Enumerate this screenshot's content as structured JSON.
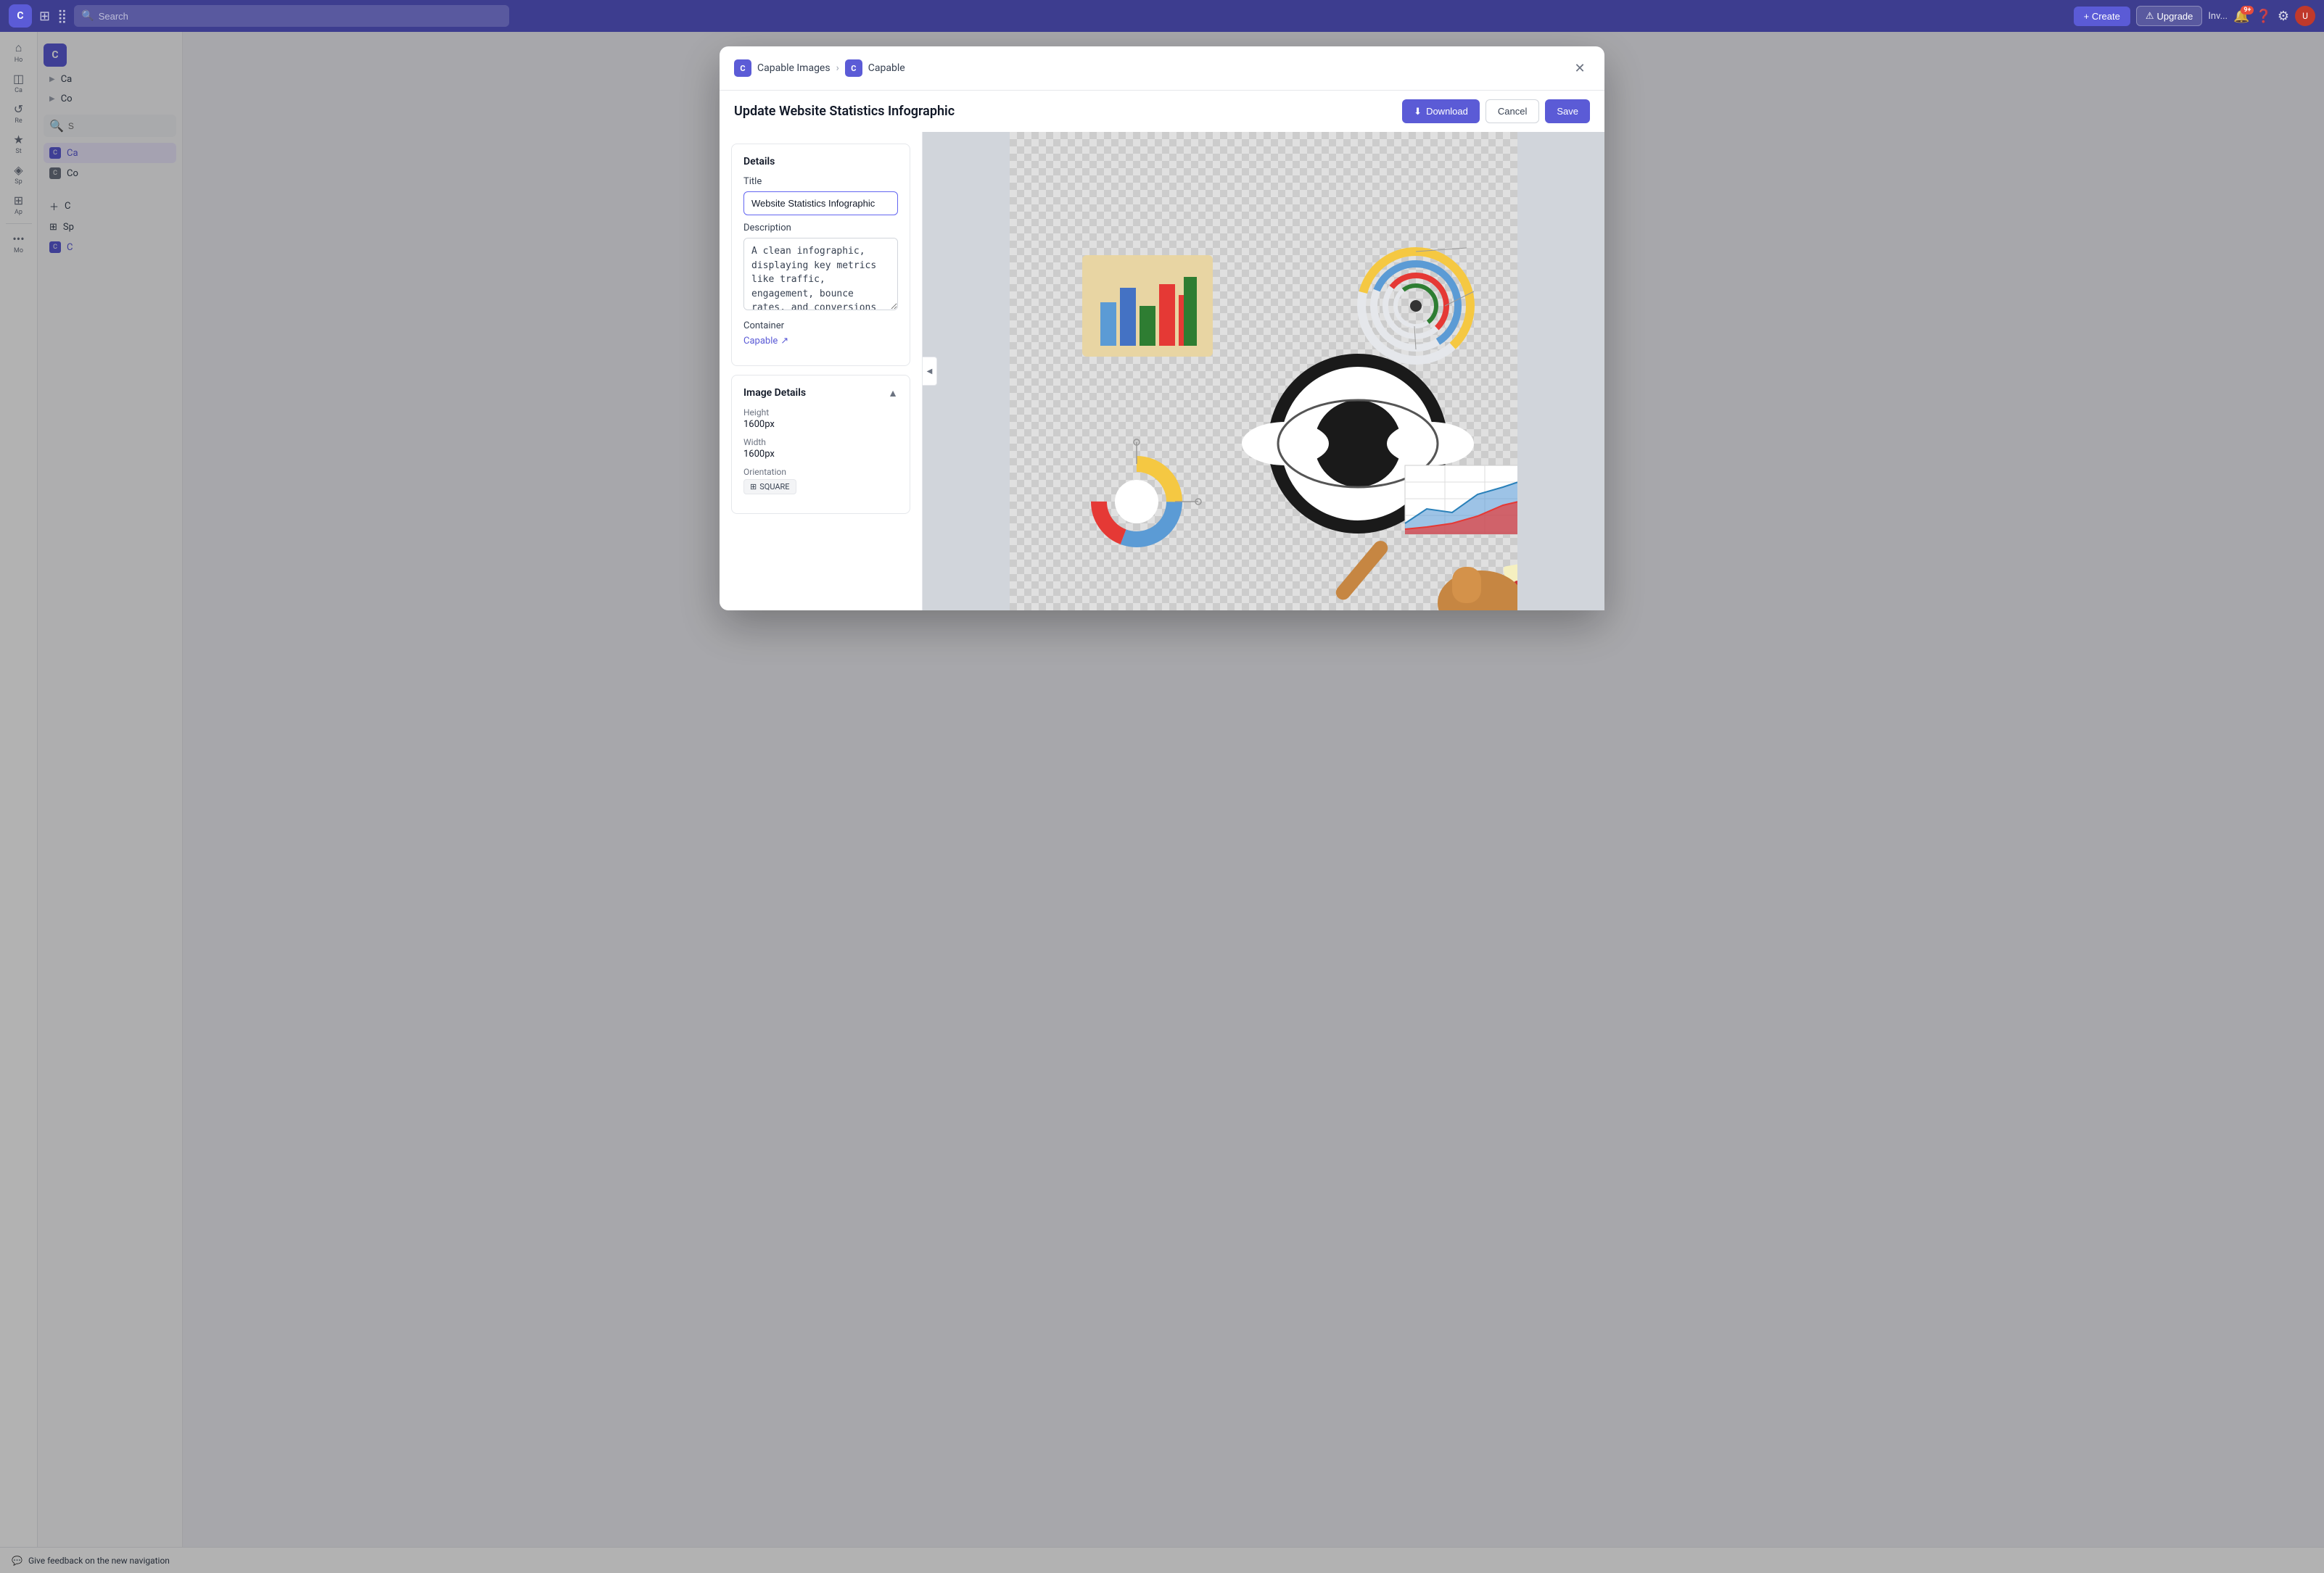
{
  "topbar": {
    "logo_label": "C",
    "search_placeholder": "Search",
    "create_label": "+ Create",
    "upgrade_label": "Upgrade",
    "notification_badge": "9+",
    "avatar_label": "U"
  },
  "sidebar": {
    "items": [
      {
        "label": "Ho",
        "icon": "⌂",
        "id": "home"
      },
      {
        "label": "Ca",
        "icon": "◫",
        "id": "canvas"
      },
      {
        "label": "Re",
        "icon": "↺",
        "id": "recent"
      },
      {
        "label": "St",
        "icon": "★",
        "id": "starred"
      },
      {
        "label": "Sp",
        "icon": "◈",
        "id": "spaces"
      },
      {
        "label": "Ap",
        "icon": "⊞",
        "id": "apps"
      },
      {
        "label": "Mo",
        "icon": "•••",
        "id": "more"
      }
    ]
  },
  "inner_sidebar": {
    "logo": "C",
    "items": [
      {
        "label": "Ca",
        "id": "ca1",
        "expandable": true
      },
      {
        "label": "Co",
        "id": "co1",
        "expandable": true
      },
      {
        "label": "S",
        "id": "search",
        "is_search": true
      },
      {
        "label": "Ca",
        "id": "ca2",
        "expandable": true,
        "active": false
      },
      {
        "label": "Co",
        "id": "co2",
        "expandable": true,
        "active": false
      }
    ],
    "actions": [
      {
        "label": "+ C",
        "id": "add"
      },
      {
        "label": "Sp",
        "id": "spaces"
      },
      {
        "label": "C",
        "id": "current",
        "active": true
      }
    ]
  },
  "dialog": {
    "breadcrumb": {
      "logo": "C",
      "parent": "Capable Images",
      "sep": "›",
      "child_logo": "C",
      "child": "Capable"
    },
    "title": "Update Website Statistics Infographic",
    "buttons": {
      "download": "Download",
      "cancel": "Cancel",
      "save": "Save"
    },
    "details_panel": {
      "section_title": "Details",
      "title_label": "Title",
      "title_value": "Website Statistics Infographic",
      "description_label": "Description",
      "description_value": "A clean infographic, displaying key metrics like traffic, engagement, bounce rates, and conversions with charts and icons for quick insights.",
      "container_label": "Container",
      "container_link": "Capable"
    },
    "image_details_panel": {
      "section_title": "Image Details",
      "height_label": "Height",
      "height_value": "1600px",
      "width_label": "Width",
      "width_value": "1600px",
      "orientation_label": "Orientation",
      "orientation_value": "SQUARE",
      "orientation_icon": "⊞"
    }
  },
  "feedback": {
    "label": "Give feedback on the new navigation"
  }
}
